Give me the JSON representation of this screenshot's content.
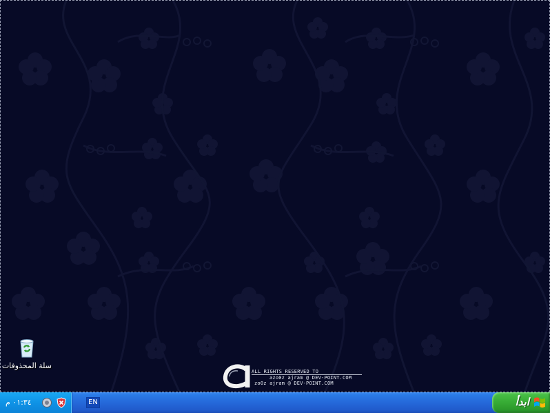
{
  "desktop": {
    "recycle_bin_label": "سلة المحذوفات",
    "branding": {
      "line1": "ALL RIGHTS RESERVED TO",
      "line2": "azo0z ajram @ DEV-POINT.COM",
      "line3": "zo0z ajram @ DEV-POINT.COM"
    }
  },
  "taskbar": {
    "clock": "٠١:٣٤ م",
    "language": "EN",
    "start_label": "ابدأ",
    "tray_icons": [
      "volume-icon",
      "security-shield-icon"
    ]
  },
  "colors": {
    "desktop_bg": "#070a26",
    "taskbar_blue": "#2466d8",
    "tray_blue": "#0f93e6",
    "start_green": "#38ad36"
  }
}
